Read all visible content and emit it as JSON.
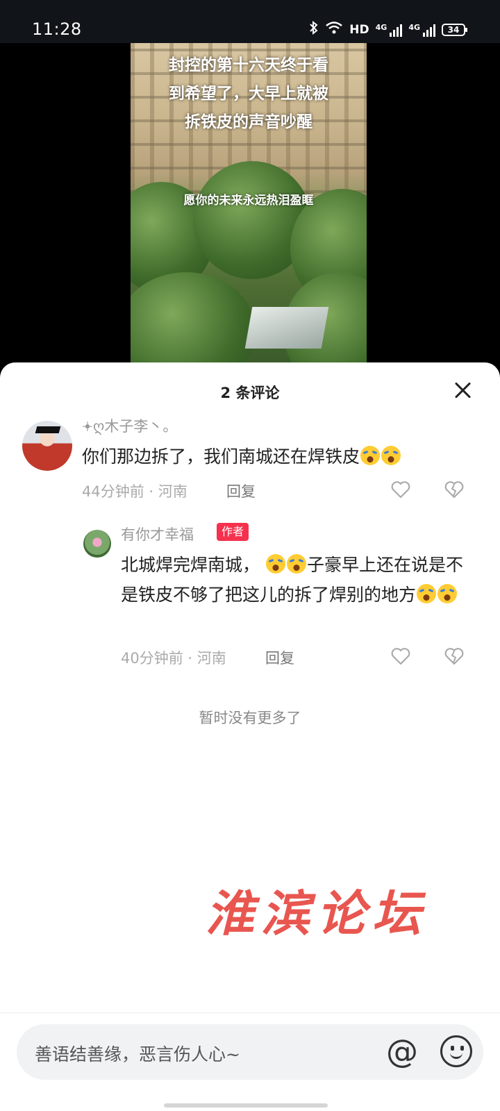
{
  "status_bar": {
    "time": "11:28",
    "hd_label": "HD",
    "net1": "4G",
    "net2": "4G",
    "battery": "34"
  },
  "video": {
    "caption_main": "封控的第十六天终于看\n到希望了，大早上就被\n拆铁皮的声音吵醒",
    "caption_sub": "愿你的未来永远热泪盈眶"
  },
  "comments_sheet": {
    "title": "2 条评论",
    "comments": [
      {
        "username": "𖥔ღ木子李丶。",
        "text": "你们那边拆了，我们南城还在焊铁皮",
        "emoji_count": 2,
        "time_location": "44分钟前 · 河南",
        "reply_label": "回复"
      },
      {
        "username": "有你才幸福",
        "badge": "作者",
        "text_part1": "北城焊完焊南城，",
        "text_part2": "子豪早上还在说是不是铁皮不够了把这儿的拆了焊别的地方",
        "time_location": "40分钟前 · 河南",
        "reply_label": "回复"
      }
    ],
    "no_more_text": "暂时没有更多了"
  },
  "watermark": "淮滨论坛",
  "input_bar": {
    "placeholder": "善语结善缘，恶言伤人心~",
    "at_symbol": "@"
  },
  "colors": {
    "badge": "#f5314e",
    "watermark": "#e8564f"
  }
}
